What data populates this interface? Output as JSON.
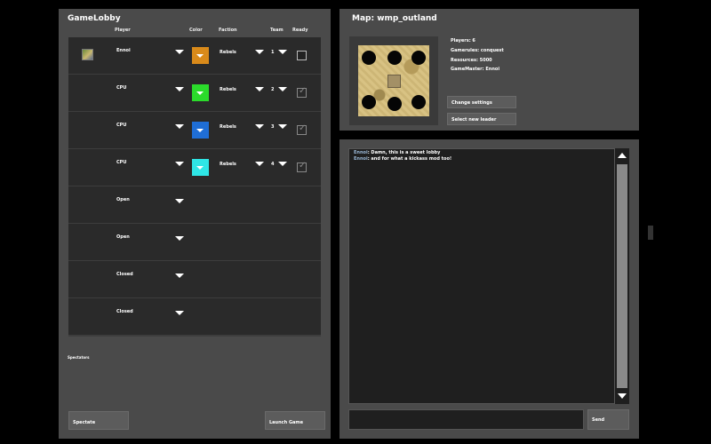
{
  "lobby": {
    "title": "GameLobby",
    "headers": {
      "player": "Player",
      "color": "Color",
      "faction": "Faction",
      "team": "Team",
      "ready": "Ready"
    },
    "slots": [
      {
        "name": "Ennoi",
        "color": "#d98a1a",
        "faction": "Rebels",
        "team": "1",
        "ready": false
      },
      {
        "name": "CPU",
        "color": "#2bdc2b",
        "faction": "Rebels",
        "team": "2",
        "ready": true
      },
      {
        "name": "CPU",
        "color": "#1f6ed6",
        "faction": "Rebels",
        "team": "3",
        "ready": true
      },
      {
        "name": "CPU",
        "color": "#2fe6e6",
        "faction": "Rebels",
        "team": "4",
        "ready": true
      },
      {
        "name": "Open"
      },
      {
        "name": "Open"
      },
      {
        "name": "Closed"
      },
      {
        "name": "Closed"
      }
    ],
    "spectators_label": "Spectators",
    "spectate_label": "Spectate",
    "launch_label": "Launch Game"
  },
  "map": {
    "title": "Map: wmp_outland",
    "players": "Players: 6",
    "gamerules": "Gamerules: conquest",
    "resources": "Resources: 5000",
    "gamemaster": "GameMaster: Ennoi",
    "change_settings_label": "Change settings",
    "select_leader_label": "Select new leader"
  },
  "chat": {
    "messages": [
      {
        "user": "Ennoi",
        "text": ": Damn, this is a sweet lobby"
      },
      {
        "user": "Ennoi",
        "text": ": and for what a kickass mod too!"
      }
    ],
    "input_value": "",
    "send_label": "Send"
  },
  "colors": {
    "panel": "#4a4a4a",
    "slot": "#2a2a2a",
    "button": "#5c5c5c"
  }
}
